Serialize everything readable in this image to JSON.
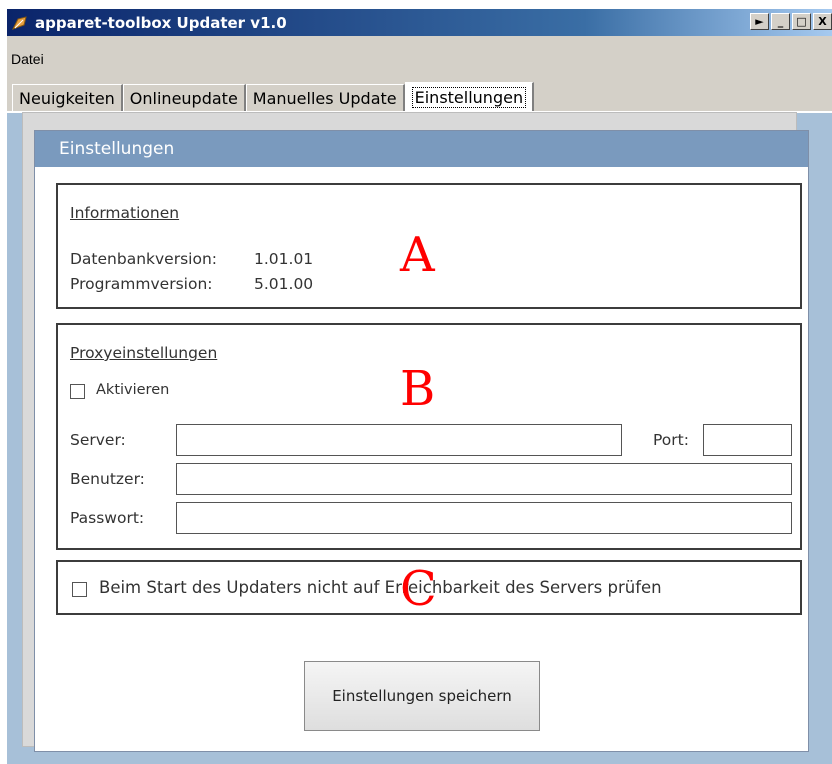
{
  "window": {
    "title": "apparet-toolbox Updater v1.0",
    "caption_buttons": [
      "►",
      "_",
      "□",
      "X"
    ]
  },
  "menu": {
    "items": [
      "Datei"
    ]
  },
  "tabs": [
    {
      "label": "Neuigkeiten",
      "active": false
    },
    {
      "label": "Onlineupdate",
      "active": false
    },
    {
      "label": "Manuelles Update",
      "active": false
    },
    {
      "label": "Einstellungen",
      "active": true
    }
  ],
  "panel": {
    "header": "Einstellungen",
    "info": {
      "heading": "Informationen",
      "db_version_label": "Datenbankversion:",
      "db_version": "1.01.01",
      "prog_version_label": "Programmversion:",
      "prog_version": "5.01.00"
    },
    "proxy": {
      "heading": "Proxyeinstellungen",
      "activate_label": "Aktivieren",
      "activate_checked": false,
      "server_label": "Server:",
      "server_value": "",
      "port_label": "Port:",
      "port_value": "",
      "user_label": "Benutzer:",
      "user_value": "",
      "password_label": "Passwort:",
      "password_value": ""
    },
    "startup": {
      "label": "Beim Start des Updaters nicht auf Erreichbarkeit des Servers prüfen",
      "checked": false
    },
    "save_button": "Einstellungen speichern"
  },
  "annotations": [
    "A",
    "B",
    "C"
  ],
  "colors": {
    "titlebar_start": "#0a246a",
    "panel_header": "#7a9abe",
    "annotation": "#ff0000"
  }
}
